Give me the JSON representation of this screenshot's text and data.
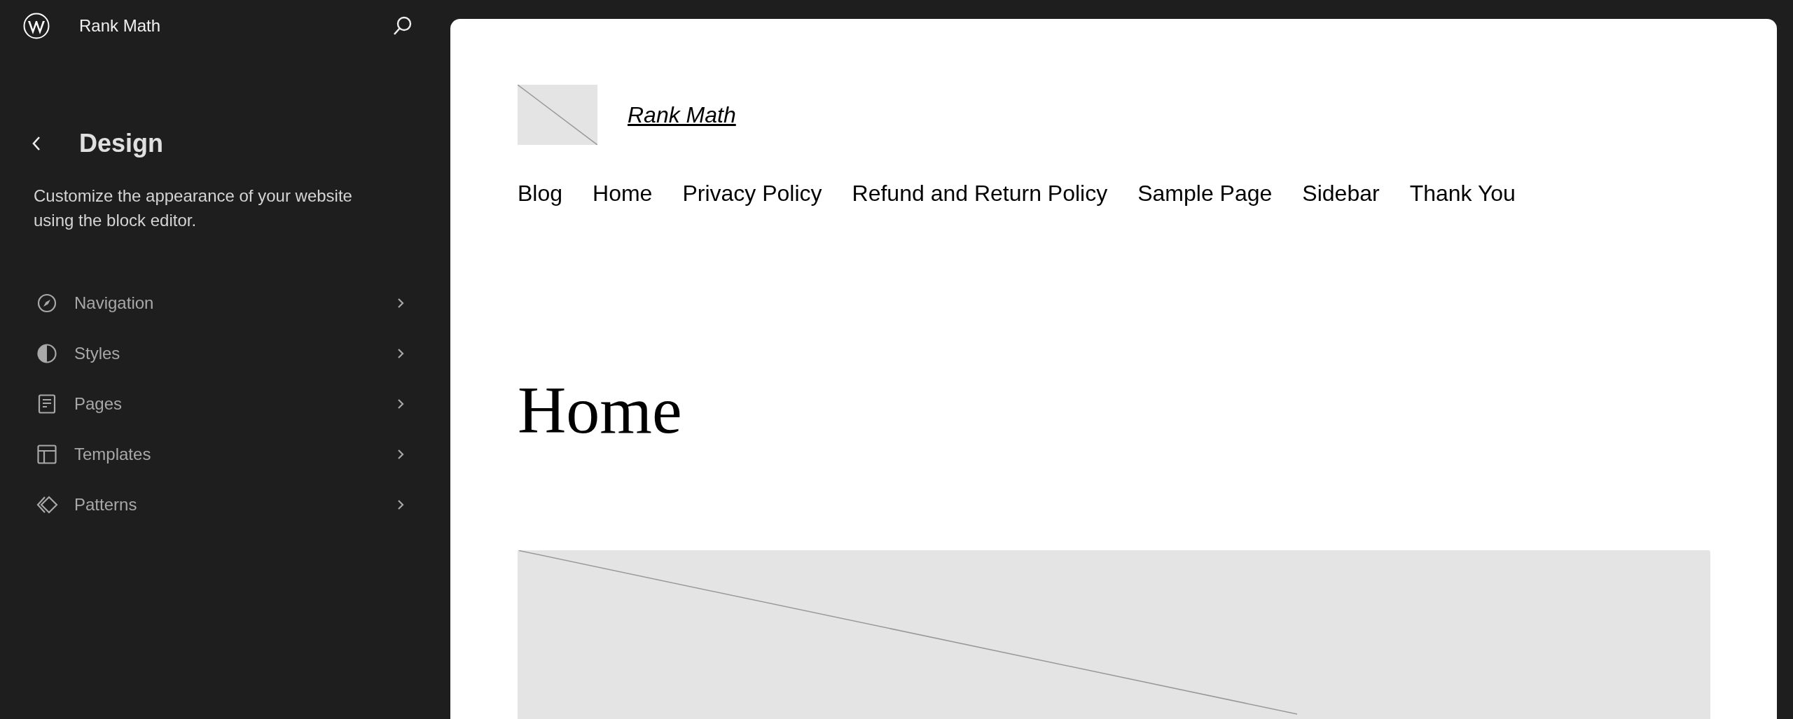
{
  "header": {
    "site_name": "Rank Math"
  },
  "panel": {
    "title": "Design",
    "description": "Customize the appearance of your website using the block editor."
  },
  "menu": [
    {
      "label": "Navigation"
    },
    {
      "label": "Styles"
    },
    {
      "label": "Pages"
    },
    {
      "label": "Templates"
    },
    {
      "label": "Patterns"
    }
  ],
  "canvas": {
    "site_title": "Rank Math",
    "nav": [
      "Blog",
      "Home",
      "Privacy Policy",
      "Refund and Return Policy",
      "Sample Page",
      "Sidebar",
      "Thank You"
    ],
    "page_title": "Home"
  }
}
